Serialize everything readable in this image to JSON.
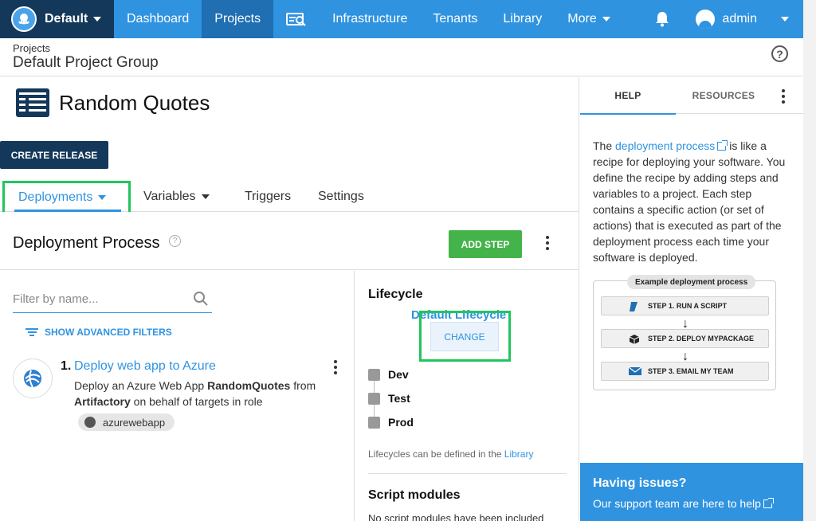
{
  "nav": {
    "space_name": "Default",
    "items": [
      "Dashboard",
      "Projects",
      "Infrastructure",
      "Tenants",
      "Library",
      "More"
    ],
    "user": "admin"
  },
  "header": {
    "breadcrumb": "Projects",
    "group_title": "Default Project Group"
  },
  "project": {
    "title": "Random Quotes",
    "create_release_label": "CREATE RELEASE"
  },
  "tabs": [
    "Deployments",
    "Variables",
    "Triggers",
    "Settings"
  ],
  "process": {
    "title": "Deployment Process",
    "add_step_label": "ADD STEP",
    "filter_placeholder": "Filter by name...",
    "advanced_filters_label": "SHOW ADVANCED FILTERS",
    "steps": [
      {
        "number": "1.",
        "name": "Deploy web app to Azure",
        "desc_prefix": "Deploy an Azure Web App ",
        "desc_app": "RandomQuotes",
        "desc_mid": " from ",
        "desc_feed": "Artifactory",
        "desc_suffix": " on behalf of targets in role",
        "role": "azurewebapp"
      }
    ]
  },
  "lifecycle": {
    "title": "Lifecycle",
    "name": "Default Lifecycle",
    "change_label": "CHANGE",
    "phases": [
      "Dev",
      "Test",
      "Prod"
    ],
    "note_prefix": "Lifecycles can be defined in the ",
    "note_link": "Library",
    "script_modules_title": "Script modules",
    "script_modules_text": "No script modules have been included"
  },
  "help": {
    "tabs": [
      "HELP",
      "RESOURCES"
    ],
    "link_text": "deployment process",
    "text_body": " is like a recipe for deploying your software. You define the recipe by adding steps and variables to a project. Each step contains a specific action (or set of actions) that is executed as part of the deployment process each time your software is deployed.",
    "prefix": "The ",
    "example_title": "Example deployment process",
    "example_steps": [
      "STEP 1. RUN A SCRIPT",
      "STEP 2. DEPLOY MYPACKAGE",
      "STEP 3. EMAIL MY TEAM"
    ],
    "issues_title": "Having issues?",
    "issues_text": "Our support team are here to help"
  },
  "colors": {
    "nav_blue": "#2f93e0",
    "nav_dark": "#14385a",
    "highlight_green": "#21c55d",
    "add_step_green": "#44b34a"
  }
}
